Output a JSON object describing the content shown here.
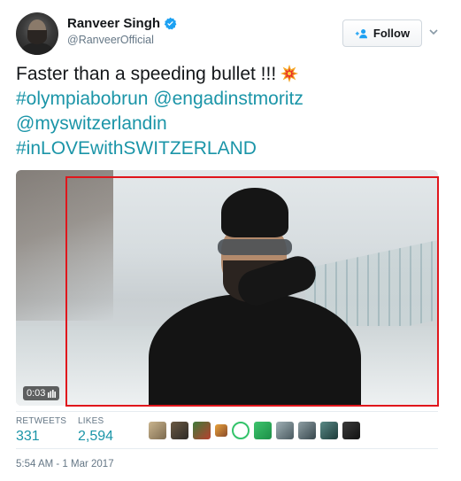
{
  "header": {
    "display_name": "Ranveer Singh",
    "handle": "@RanveerOfficial",
    "follow_label": "Follow"
  },
  "tweet": {
    "line1": "Faster than a speeding bullet !!!",
    "line2_link1": "#olympiabobrun",
    "line2_link2": "@engadinstmoritz",
    "line3_link": "@myswitzerlandin",
    "line4_link": "#inLOVEwithSWITZERLAND"
  },
  "media": {
    "timecode": "0:03"
  },
  "stats": {
    "retweets_label": "RETWEETS",
    "retweets_value": "331",
    "likes_label": "LIKES",
    "likes_value": "2,594"
  },
  "timestamp": "5:54 AM - 1 Mar 2017",
  "colors": {
    "link": "#1b95a8",
    "verified": "#1da1f2",
    "highlight": "#e0161c"
  },
  "icons": {
    "verified": "verified-badge-icon",
    "follow": "add-person-icon",
    "menu": "chevron-down-icon",
    "emoji": "collision-emoji",
    "video": "volume-bars-icon"
  }
}
